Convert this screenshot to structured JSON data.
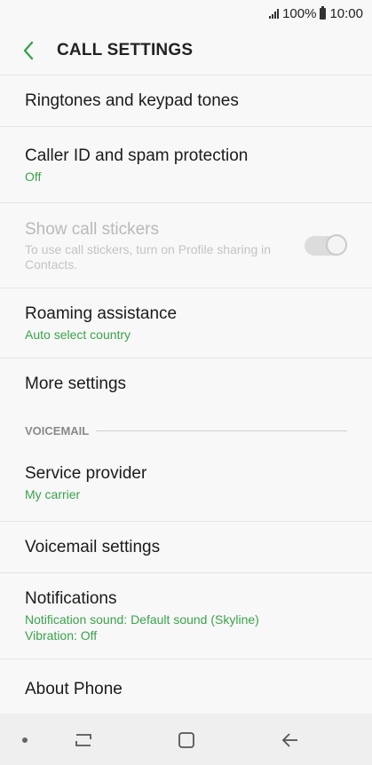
{
  "status": {
    "battery": "100%",
    "time": "10:00"
  },
  "header": {
    "title": "CALL SETTINGS"
  },
  "items": [
    {
      "title": "Ringtones and keypad tones"
    },
    {
      "title": "Caller ID and spam protection",
      "sub": "Off"
    },
    {
      "title": "Show call stickers",
      "sub": "To use call stickers, turn on Profile sharing in Contacts."
    },
    {
      "title": "Roaming assistance",
      "sub": "Auto select country"
    },
    {
      "title": "More settings"
    }
  ],
  "voicemail": {
    "header": "VOICEMAIL",
    "items": [
      {
        "title": "Service provider",
        "sub": "My carrier"
      },
      {
        "title": "Voicemail settings"
      },
      {
        "title": "Notifications",
        "sub": "Notification sound: Default sound (Skyline)",
        "sub2": "Vibration: Off"
      },
      {
        "title": "About Phone"
      }
    ]
  },
  "colors": {
    "accent": "#3aa24a"
  },
  "icons": {
    "back": "back-arrow-icon",
    "recents": "recents-icon",
    "home": "home-icon",
    "nav_back": "back-icon"
  }
}
